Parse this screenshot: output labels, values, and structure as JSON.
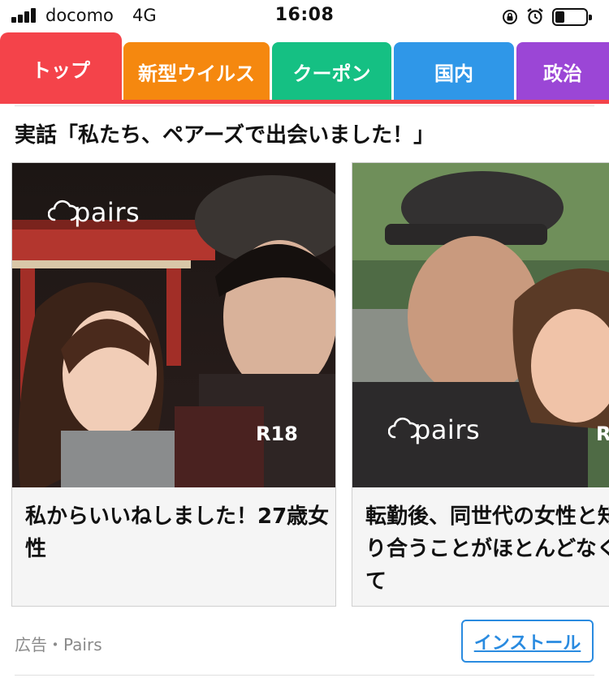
{
  "status_bar": {
    "carrier": "docomo",
    "network": "4G",
    "time": "16:08",
    "battery_level": 0.3
  },
  "tabs": [
    {
      "label": "トップ",
      "color": "#f4434a",
      "active": true
    },
    {
      "label": "新型ウイルス",
      "color": "#f5880f",
      "active": false
    },
    {
      "label": "クーポン",
      "color": "#15c083",
      "active": false
    },
    {
      "label": "国内",
      "color": "#2f97e8",
      "active": false
    },
    {
      "label": "政治",
      "color": "#9b46d6",
      "active": false
    }
  ],
  "ad": {
    "heading": "実話「私たち、ペアーズで出会いました！」",
    "cards": [
      {
        "title": "私からいいねしました！27歳女性",
        "logo": "pairs",
        "badge": "R18"
      },
      {
        "title": "転勤後、同世代の女性と知り合うことがほとんどなくて",
        "logo": "pairs",
        "badge": "R"
      }
    ],
    "sponsor_label": "広告・Pairs",
    "install_label": "インストール"
  },
  "colors": {
    "accent": "#f4434a",
    "link": "#2a8be0"
  }
}
